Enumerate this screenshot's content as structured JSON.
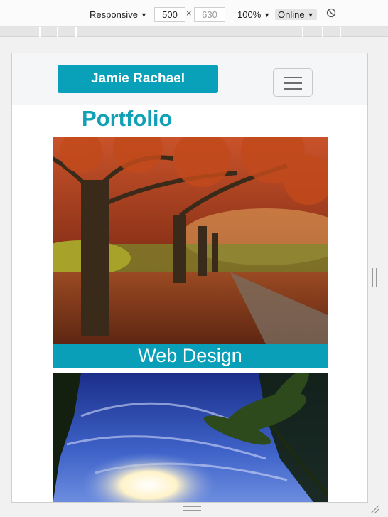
{
  "toolbar": {
    "device": "Responsive",
    "width_value": "500",
    "height_placeholder": "630",
    "dim_separator": "×",
    "zoom": "100%",
    "network": "Online"
  },
  "site": {
    "brand": "Jamie Rachael",
    "title": "Portfolio",
    "items": [
      {
        "caption": "Web Design"
      }
    ]
  },
  "colors": {
    "brand": "#09a1b9",
    "title": "#11a0b6"
  }
}
